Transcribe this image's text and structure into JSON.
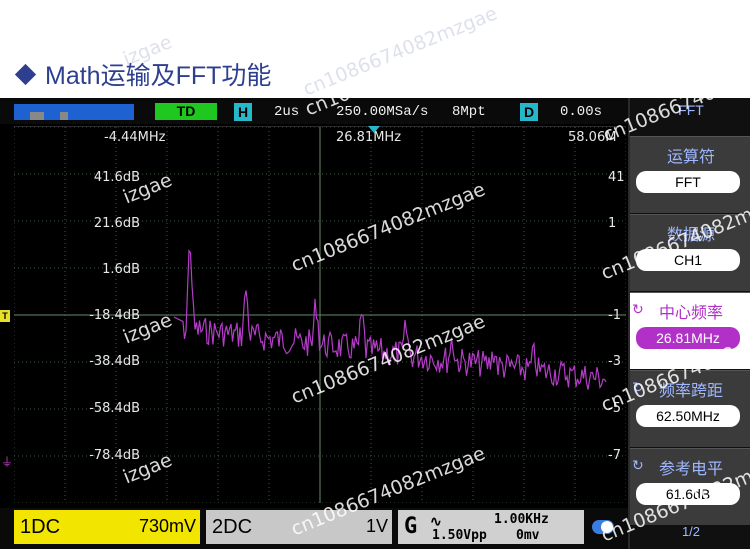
{
  "heading": {
    "text": "Math运输及FFT功能"
  },
  "top_bar": {
    "trigger_mode": "TD",
    "h_label": "H",
    "timebase": "2us",
    "sample_rate": "250.00MSa/s",
    "memory_depth": "8Mpt",
    "d_label": "D",
    "delay": "0.00s"
  },
  "freq_axis": {
    "left": "-4.44MHz",
    "center": "26.81MHz",
    "right": "58.06M"
  },
  "db_axis": [
    "41.6dB",
    "21.6dB",
    "1.6dB",
    "-18.4dB",
    "-38.4dB",
    "-58.4dB",
    "-78.4dB"
  ],
  "right_edge_labels": [
    "41",
    "1",
    "-1",
    "-3",
    "-5",
    "-7"
  ],
  "markers": {
    "trigger": "T",
    "ground": "⏚"
  },
  "menu": {
    "title": "FFT",
    "items": [
      {
        "label": "运算符",
        "value": "FFT"
      },
      {
        "label": "数据源",
        "value": "CH1"
      },
      {
        "label": "中心频率",
        "value": "26.81MHz"
      },
      {
        "label": "频率跨距",
        "value": "62.50MHz"
      },
      {
        "label": "参考电平",
        "value": "61.6dB"
      }
    ],
    "page": "1/2"
  },
  "bottom": {
    "ch1_label": "1DC",
    "ch1_scale": "730mV",
    "ch2_label": "2DC",
    "ch2_scale": "1V",
    "gen_label": "G",
    "gen_wave": "∿",
    "gen_freq": "1.00KHz",
    "gen_vpp": "1.50Vpp",
    "gen_offset": "0mv"
  },
  "watermark": "cn1086674082mzgae",
  "watermark_short": "izgae",
  "colors": {
    "trace": "#b43cc8",
    "grid": "#3c5a3c",
    "ch1": "#f2e600",
    "timebase_h": "#26b8c8",
    "td": "#1ec81e"
  }
}
